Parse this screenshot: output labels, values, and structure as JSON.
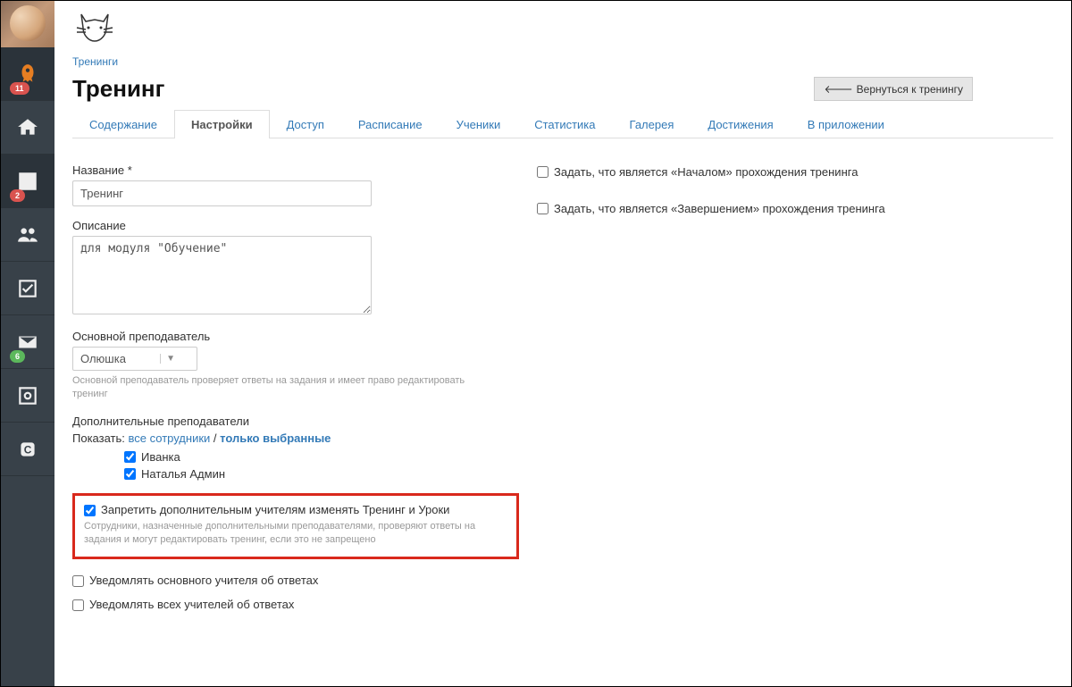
{
  "sidebar": {
    "badges": {
      "rocket": "11",
      "chart": "2",
      "mail": "6"
    }
  },
  "breadcrumb": {
    "trainings": "Тренинги"
  },
  "header": {
    "title": "Тренинг",
    "back_button": "Вернуться к тренингу"
  },
  "tabs": {
    "content": "Содержание",
    "settings": "Настройки",
    "access": "Доступ",
    "schedule": "Расписание",
    "students": "Ученики",
    "stats": "Статистика",
    "gallery": "Галерея",
    "achievements": "Достижения",
    "in_app": "В приложении"
  },
  "form": {
    "name_label": "Название *",
    "name_value": "Тренинг",
    "desc_label": "Описание",
    "desc_value": "для модуля \"Обучение\"",
    "teacher_label": "Основной преподаватель",
    "teacher_value": "Олюшка",
    "teacher_help": "Основной преподаватель проверяет ответы на задания и имеет право редактировать тренинг",
    "extra_teachers_label": "Дополнительные преподаватели",
    "show_label": "Показать:",
    "show_all": "все сотрудники",
    "show_separator": " / ",
    "show_selected": "только выбранные",
    "teachers": {
      "t1": "Иванка",
      "t2": "Наталья Админ"
    }
  },
  "restrict": {
    "label": "Запретить дополнительным учителям изменять Тренинг и Уроки",
    "help": "Сотрудники, назначенные дополнительными преподавателями, проверяют ответы на задания и могут редактировать тренинг, если это не запрещено"
  },
  "notify_main": "Уведомлять основного учителя об ответах",
  "notify_all": "Уведомлять всех учителей об ответах",
  "right": {
    "start": "Задать, что является «Началом» прохождения тренинга",
    "end": "Задать, что является «Завершением» прохождения тренинга"
  }
}
